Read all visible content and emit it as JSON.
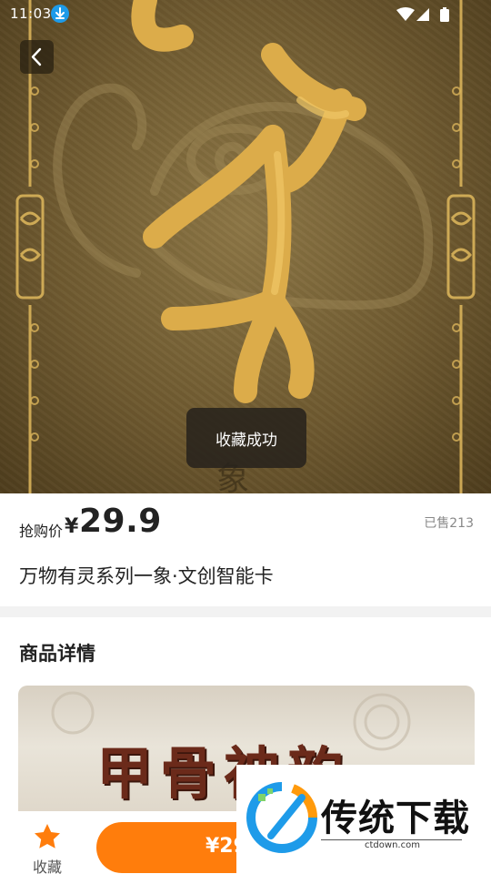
{
  "status_bar": {
    "time": "11:03"
  },
  "hero": {
    "toast": "收藏成功",
    "glyph_char": "象"
  },
  "product": {
    "price_label": "抢购价",
    "currency": "¥",
    "price": "29.9",
    "sold": "已售213",
    "title": "万物有灵系列一象·文创智能卡"
  },
  "details": {
    "section_title": "商品详情",
    "image_heading": "甲骨神韵"
  },
  "bottom_bar": {
    "favorite_label": "收藏",
    "buy_label": "¥29"
  },
  "watermark": {
    "brand": "传统下载",
    "url": "ctdown.com"
  },
  "colors": {
    "accent": "#ff7d0c",
    "gold": "#d9a23c",
    "brown": "#6f5a30",
    "icon_blue": "#1e9be9"
  }
}
